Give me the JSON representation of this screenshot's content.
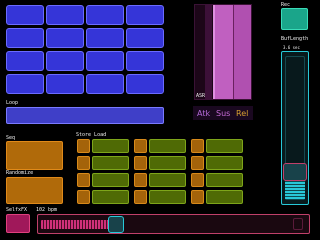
{
  "labels": {
    "loop": "Loop",
    "seq": "Seq",
    "randomize": "Randomize",
    "store_load": "Store  Load",
    "selfx": "SelfxFX",
    "bpm": "102 bpm",
    "asr": "ASR",
    "rec": "Rec",
    "buflength": "BufLength",
    "buflength_value": "3.6 sec"
  },
  "envelope": {
    "attack": "Atk",
    "sustain": "Sus",
    "release": "Rel"
  },
  "colors": {
    "pad_blue": "#3535d8",
    "orange": "#b06a0a",
    "green": "#4f6a05",
    "magenta": "#c060c0",
    "teal": "#1aa58a",
    "cyan": "#28c8d8"
  },
  "bpm_slider_fraction": 0.27,
  "buflength_fraction": 0.2
}
